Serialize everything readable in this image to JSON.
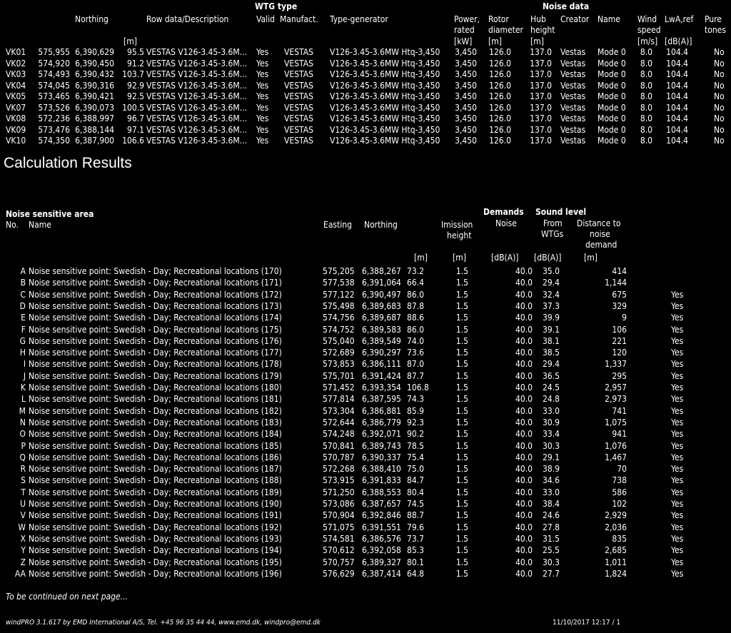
{
  "wtg": {
    "group_wtg_type": "WTG type",
    "group_noise_data": "Noise data",
    "headers": {
      "northing": "Northing",
      "row_desc": "Row data/Description",
      "valid": "Valid",
      "manufact": "Manufact.",
      "type_gen": "Type-generator",
      "power_1": "Power,",
      "power_2": "rated",
      "power_unit": "[kW]",
      "rotor_1": "Rotor",
      "rotor_2": "diameter",
      "rotor_unit": "[m]",
      "hub_1": "Hub",
      "hub_2": "height",
      "hub_unit": "[m]",
      "creator": "Creator",
      "name": "Name",
      "wind_1": "Wind",
      "wind_2": "speed",
      "wind_unit": "[m/s]",
      "lwa": "LwA,ref",
      "lwa_unit": "[dB(A)]",
      "pure_1": "Pure",
      "pure_2": "tones",
      "z_unit": "[m]"
    },
    "rows": [
      {
        "id": "VK01",
        "easting": "575,955",
        "northing": "6,390,629",
        "z": "95.5",
        "desc": "VESTAS V126-3.45-3.6M...",
        "valid": "Yes",
        "manuf": "VESTAS",
        "type": "V126-3.45-3.6MW Htq-3,450",
        "power": "3,450",
        "rotor": "126.0",
        "hub": "137.0",
        "creator": "Vestas",
        "name": "Mode 0",
        "wind": "8.0",
        "lwa": "104.4",
        "pure": "No"
      },
      {
        "id": "VK02",
        "easting": "574,920",
        "northing": "6,390,450",
        "z": "91.2",
        "desc": "VESTAS V126-3.45-3.6M...",
        "valid": "Yes",
        "manuf": "VESTAS",
        "type": "V126-3.45-3.6MW Htq-3,450",
        "power": "3,450",
        "rotor": "126.0",
        "hub": "137.0",
        "creator": "Vestas",
        "name": "Mode 0",
        "wind": "8.0",
        "lwa": "104.4",
        "pure": "No"
      },
      {
        "id": "VK03",
        "easting": "574,493",
        "northing": "6,390,432",
        "z": "103.7",
        "desc": "VESTAS V126-3.45-3.6M...",
        "valid": "Yes",
        "manuf": "VESTAS",
        "type": "V126-3.45-3.6MW Htq-3,450",
        "power": "3,450",
        "rotor": "126.0",
        "hub": "137.0",
        "creator": "Vestas",
        "name": "Mode 0",
        "wind": "8.0",
        "lwa": "104.4",
        "pure": "No"
      },
      {
        "id": "VK04",
        "easting": "574,045",
        "northing": "6,390,316",
        "z": "92.9",
        "desc": "VESTAS V126-3.45-3.6M...",
        "valid": "Yes",
        "manuf": "VESTAS",
        "type": "V126-3.45-3.6MW Htq-3,450",
        "power": "3,450",
        "rotor": "126.0",
        "hub": "137.0",
        "creator": "Vestas",
        "name": "Mode 0",
        "wind": "8.0",
        "lwa": "104.4",
        "pure": "No"
      },
      {
        "id": "VK05",
        "easting": "573,465",
        "northing": "6,390,421",
        "z": "92.5",
        "desc": "VESTAS V126-3.45-3.6M...",
        "valid": "Yes",
        "manuf": "VESTAS",
        "type": "V126-3.45-3.6MW Htq-3,450",
        "power": "3,450",
        "rotor": "126.0",
        "hub": "137.0",
        "creator": "Vestas",
        "name": "Mode 0",
        "wind": "8.0",
        "lwa": "104.4",
        "pure": "No"
      },
      {
        "id": "VK07",
        "easting": "573,526",
        "northing": "6,390,073",
        "z": "100.5",
        "desc": "VESTAS V126-3.45-3.6M...",
        "valid": "Yes",
        "manuf": "VESTAS",
        "type": "V126-3.45-3.6MW Htq-3,450",
        "power": "3,450",
        "rotor": "126.0",
        "hub": "137.0",
        "creator": "Vestas",
        "name": "Mode 0",
        "wind": "8.0",
        "lwa": "104.4",
        "pure": "No"
      },
      {
        "id": "VK08",
        "easting": "572,236",
        "northing": "6,388,997",
        "z": "96.7",
        "desc": "VESTAS V126-3.45-3.6M...",
        "valid": "Yes",
        "manuf": "VESTAS",
        "type": "V126-3.45-3.6MW Htq-3,450",
        "power": "3,450",
        "rotor": "126.0",
        "hub": "137.0",
        "creator": "Vestas",
        "name": "Mode 0",
        "wind": "8.0",
        "lwa": "104.4",
        "pure": "No"
      },
      {
        "id": "VK09",
        "easting": "573,476",
        "northing": "6,388,144",
        "z": "97.1",
        "desc": "VESTAS V126-3.45-3.6M...",
        "valid": "Yes",
        "manuf": "VESTAS",
        "type": "V126-3.45-3.6MW Htq-3,450",
        "power": "3,450",
        "rotor": "126.0",
        "hub": "137.0",
        "creator": "Vestas",
        "name": "Mode 0",
        "wind": "8.0",
        "lwa": "104.4",
        "pure": "No"
      },
      {
        "id": "VK10",
        "easting": "574,350",
        "northing": "6,387,900",
        "z": "106.6",
        "desc": "VESTAS V126-3.45-3.6M...",
        "valid": "Yes",
        "manuf": "VESTAS",
        "type": "V126-3.45-3.6MW Htq-3,450",
        "power": "3,450",
        "rotor": "126.0",
        "hub": "137.0",
        "creator": "Vestas",
        "name": "Mode 0",
        "wind": "8.0",
        "lwa": "104.4",
        "pure": "No"
      }
    ]
  },
  "section_title": "Calculation Results",
  "noise": {
    "group_area": "Noise sensitive area",
    "group_demands": "Demands",
    "group_sound": "Sound level",
    "headers": {
      "no": "No.",
      "name": "Name",
      "easting": "Easting",
      "northing": "Northing",
      "imission_1": "Imission",
      "imission_2": "height",
      "noise": "Noise",
      "from_1": "From",
      "from_2": "WTGs",
      "dist_1": "Distance to",
      "dist_2": "noise",
      "dist_3": "demand",
      "u_z": "[m]",
      "u_im": "[m]",
      "u_noise": "[dB(A)]",
      "u_from": "[dB(A)]",
      "u_dist": "[m]"
    },
    "rows": [
      {
        "no": "A",
        "name": "Noise sensitive point: Swedish - Day; Recreational locations (170)",
        "easting": "575,205",
        "northing": "6,388,267",
        "z": "73.2",
        "im": "1.5",
        "noise": "40.0",
        "from": "35.0",
        "dist": "414",
        "ok": ""
      },
      {
        "no": "B",
        "name": "Noise sensitive point: Swedish - Day; Recreational locations (171)",
        "easting": "577,538",
        "northing": "6,391,064",
        "z": "66.4",
        "im": "1.5",
        "noise": "40.0",
        "from": "29.4",
        "dist": "1,144",
        "ok": ""
      },
      {
        "no": "C",
        "name": "Noise sensitive point: Swedish - Day; Recreational locations (172)",
        "easting": "577,122",
        "northing": "6,390,497",
        "z": "86.0",
        "im": "1.5",
        "noise": "40.0",
        "from": "32.4",
        "dist": "675",
        "ok": "Yes"
      },
      {
        "no": "D",
        "name": "Noise sensitive point: Swedish - Day; Recreational locations (173)",
        "easting": "575,498",
        "northing": "6,389,683",
        "z": "87.8",
        "im": "1.5",
        "noise": "40.0",
        "from": "37.3",
        "dist": "329",
        "ok": "Yes"
      },
      {
        "no": "E",
        "name": "Noise sensitive point: Swedish - Day; Recreational locations (174)",
        "easting": "574,756",
        "northing": "6,389,687",
        "z": "88.6",
        "im": "1.5",
        "noise": "40.0",
        "from": "39.9",
        "dist": "9",
        "ok": "Yes"
      },
      {
        "no": "F",
        "name": "Noise sensitive point: Swedish - Day; Recreational locations (175)",
        "easting": "574,752",
        "northing": "6,389,583",
        "z": "86.0",
        "im": "1.5",
        "noise": "40.0",
        "from": "39.1",
        "dist": "106",
        "ok": "Yes"
      },
      {
        "no": "G",
        "name": "Noise sensitive point: Swedish - Day; Recreational locations (176)",
        "easting": "575,040",
        "northing": "6,389,549",
        "z": "74.0",
        "im": "1.5",
        "noise": "40.0",
        "from": "38.1",
        "dist": "221",
        "ok": "Yes"
      },
      {
        "no": "H",
        "name": "Noise sensitive point: Swedish - Day; Recreational locations (177)",
        "easting": "572,689",
        "northing": "6,390,297",
        "z": "73.6",
        "im": "1.5",
        "noise": "40.0",
        "from": "38.5",
        "dist": "120",
        "ok": "Yes"
      },
      {
        "no": "I",
        "name": "Noise sensitive point: Swedish - Day; Recreational locations (178)",
        "easting": "573,853",
        "northing": "6,386,111",
        "z": "87.0",
        "im": "1.5",
        "noise": "40.0",
        "from": "29.4",
        "dist": "1,337",
        "ok": "Yes"
      },
      {
        "no": "J",
        "name": "Noise sensitive point: Swedish - Day; Recreational locations (179)",
        "easting": "575,701",
        "northing": "6,391,424",
        "z": "87.7",
        "im": "1.5",
        "noise": "40.0",
        "from": "36.5",
        "dist": "295",
        "ok": "Yes"
      },
      {
        "no": "K",
        "name": "Noise sensitive point: Swedish - Day; Recreational locations (180)",
        "easting": "571,452",
        "northing": "6,393,354",
        "z": "106.8",
        "im": "1.5",
        "noise": "40.0",
        "from": "24.5",
        "dist": "2,957",
        "ok": "Yes"
      },
      {
        "no": "L",
        "name": "Noise sensitive point: Swedish - Day; Recreational locations (181)",
        "easting": "577,814",
        "northing": "6,387,595",
        "z": "74.3",
        "im": "1.5",
        "noise": "40.0",
        "from": "24.8",
        "dist": "2,973",
        "ok": "Yes"
      },
      {
        "no": "M",
        "name": "Noise sensitive point: Swedish - Day; Recreational locations (182)",
        "easting": "573,304",
        "northing": "6,386,881",
        "z": "85.9",
        "im": "1.5",
        "noise": "40.0",
        "from": "33.0",
        "dist": "741",
        "ok": "Yes"
      },
      {
        "no": "N",
        "name": "Noise sensitive point: Swedish - Day; Recreational locations (183)",
        "easting": "572,644",
        "northing": "6,386,779",
        "z": "92.3",
        "im": "1.5",
        "noise": "40.0",
        "from": "30.9",
        "dist": "1,075",
        "ok": "Yes"
      },
      {
        "no": "O",
        "name": "Noise sensitive point: Swedish - Day; Recreational locations (184)",
        "easting": "574,248",
        "northing": "6,392,071",
        "z": "90.2",
        "im": "1.5",
        "noise": "40.0",
        "from": "33.4",
        "dist": "941",
        "ok": "Yes"
      },
      {
        "no": "P",
        "name": "Noise sensitive point: Swedish - Day; Recreational locations (185)",
        "easting": "570,841",
        "northing": "6,389,743",
        "z": "78.5",
        "im": "1.5",
        "noise": "40.0",
        "from": "30.3",
        "dist": "1,076",
        "ok": "Yes"
      },
      {
        "no": "Q",
        "name": "Noise sensitive point: Swedish - Day; Recreational locations (186)",
        "easting": "570,787",
        "northing": "6,390,337",
        "z": "75.4",
        "im": "1.5",
        "noise": "40.0",
        "from": "29.1",
        "dist": "1,467",
        "ok": "Yes"
      },
      {
        "no": "R",
        "name": "Noise sensitive point: Swedish - Day; Recreational locations (187)",
        "easting": "572,268",
        "northing": "6,388,410",
        "z": "75.0",
        "im": "1.5",
        "noise": "40.0",
        "from": "38.9",
        "dist": "70",
        "ok": "Yes"
      },
      {
        "no": "S",
        "name": "Noise sensitive point: Swedish - Day; Recreational locations (188)",
        "easting": "573,915",
        "northing": "6,391,833",
        "z": "84.7",
        "im": "1.5",
        "noise": "40.0",
        "from": "34.6",
        "dist": "738",
        "ok": "Yes"
      },
      {
        "no": "T",
        "name": "Noise sensitive point: Swedish - Day; Recreational locations (189)",
        "easting": "571,250",
        "northing": "6,388,553",
        "z": "80.4",
        "im": "1.5",
        "noise": "40.0",
        "from": "33.0",
        "dist": "586",
        "ok": "Yes"
      },
      {
        "no": "U",
        "name": "Noise sensitive point: Swedish - Day; Recreational locations (190)",
        "easting": "573,086",
        "northing": "6,387,657",
        "z": "74.5",
        "im": "1.5",
        "noise": "40.0",
        "from": "38.4",
        "dist": "102",
        "ok": "Yes"
      },
      {
        "no": "V",
        "name": "Noise sensitive point: Swedish - Day; Recreational locations (191)",
        "easting": "570,904",
        "northing": "6,392,846",
        "z": "88.7",
        "im": "1.5",
        "noise": "40.0",
        "from": "24.6",
        "dist": "2,929",
        "ok": "Yes"
      },
      {
        "no": "W",
        "name": "Noise sensitive point: Swedish - Day; Recreational locations (192)",
        "easting": "571,075",
        "northing": "6,391,551",
        "z": "79.6",
        "im": "1.5",
        "noise": "40.0",
        "from": "27.8",
        "dist": "2,036",
        "ok": "Yes"
      },
      {
        "no": "X",
        "name": "Noise sensitive point: Swedish - Day; Recreational locations (193)",
        "easting": "574,581",
        "northing": "6,386,576",
        "z": "73.7",
        "im": "1.5",
        "noise": "40.0",
        "from": "31.5",
        "dist": "835",
        "ok": "Yes"
      },
      {
        "no": "Y",
        "name": "Noise sensitive point: Swedish - Day; Recreational locations (194)",
        "easting": "570,612",
        "northing": "6,392,058",
        "z": "85.3",
        "im": "1.5",
        "noise": "40.0",
        "from": "25.5",
        "dist": "2,685",
        "ok": "Yes"
      },
      {
        "no": "Z",
        "name": "Noise sensitive point: Swedish - Day; Recreational locations (195)",
        "easting": "570,757",
        "northing": "6,389,327",
        "z": "80.1",
        "im": "1.5",
        "noise": "40.0",
        "from": "30.3",
        "dist": "1,011",
        "ok": "Yes"
      },
      {
        "no": "AA",
        "name": "Noise sensitive point: Swedish - Day; Recreational locations (196)",
        "easting": "576,629",
        "northing": "6,387,414",
        "z": "64.8",
        "im": "1.5",
        "noise": "40.0",
        "from": "27.7",
        "dist": "1,824",
        "ok": "Yes"
      }
    ]
  },
  "continued": "To be continued on next page...",
  "footer": {
    "left": "windPRO 3.1.617  by EMD International A/S, Tel. +45 96 35 44 44, www.emd.dk, windpro@emd.dk",
    "right": "11/10/2017 12:17 / 1"
  }
}
